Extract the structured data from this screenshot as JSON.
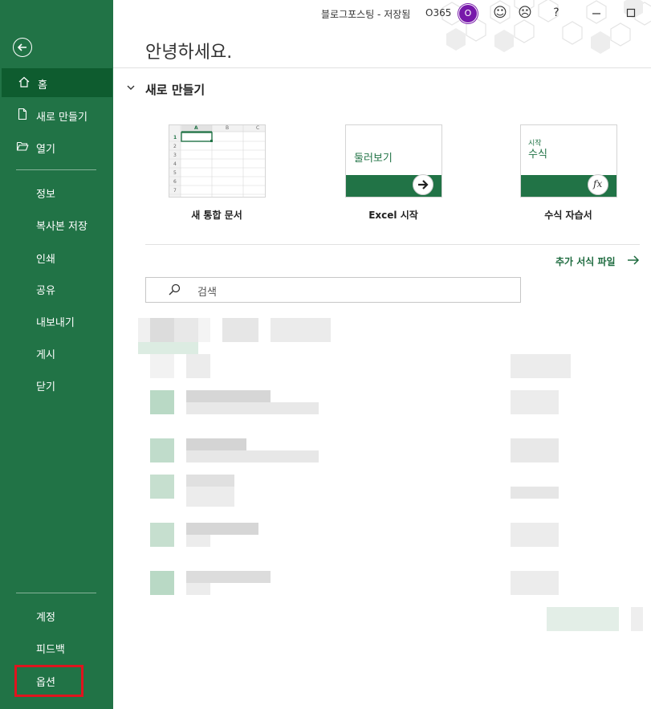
{
  "window": {
    "title": "블로그포스팅 - 저장됨",
    "account": "O365",
    "avatar_initial": "O"
  },
  "sidebar": {
    "back_label": "Back",
    "items": [
      {
        "label": "홈",
        "icon": "home-icon",
        "active": true
      },
      {
        "label": "새로 만들기",
        "icon": "new-document-icon"
      },
      {
        "label": "열기",
        "icon": "open-folder-icon"
      },
      {
        "label": "정보"
      },
      {
        "label": "복사본 저장"
      },
      {
        "label": "인쇄"
      },
      {
        "label": "공유"
      },
      {
        "label": "내보내기"
      },
      {
        "label": "게시"
      },
      {
        "label": "닫기"
      }
    ],
    "bottom_items": [
      {
        "label": "계정"
      },
      {
        "label": "피드백"
      },
      {
        "label": "옵션"
      }
    ]
  },
  "main": {
    "greeting": "안녕하세요.",
    "new_section_title": "새로 만들기",
    "templates": [
      {
        "label": "새 통합 문서"
      },
      {
        "label": "Excel 시작",
        "thumb_text": "둘러보기"
      },
      {
        "label": "수식 자습서",
        "thumb_small": "시작",
        "thumb_text": "수식"
      }
    ],
    "more_templates": "추가 서식 파일",
    "search_placeholder": "검색",
    "sheet_preview": {
      "col_a": "A",
      "col_b": "B",
      "col_c": "C",
      "rows": [
        "1",
        "2",
        "3",
        "4",
        "5",
        "6",
        "7"
      ]
    }
  },
  "colors": {
    "brand": "#217346",
    "brand_dark": "#0e5c2f",
    "highlight": "#e0141e",
    "avatar": "#7719aa"
  }
}
